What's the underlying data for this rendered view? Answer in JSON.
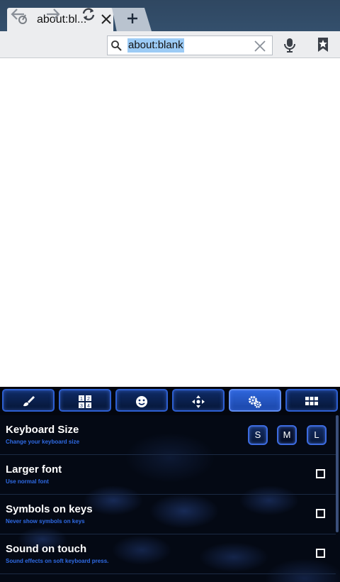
{
  "browser": {
    "tab_title": "about:bl...",
    "address_value": "about:blank"
  },
  "keyboard_tabs": [
    {
      "icon": "theme-brush-icon",
      "active": false
    },
    {
      "icon": "numpad-icon",
      "active": false
    },
    {
      "icon": "emoji-icon",
      "active": false
    },
    {
      "icon": "cursor-move-icon",
      "active": false
    },
    {
      "icon": "settings-gears-icon",
      "active": true
    },
    {
      "icon": "grid-apps-icon",
      "active": false
    }
  ],
  "settings": {
    "keyboard_size": {
      "title": "Keyboard Size",
      "subtitle": "Change your keyboard size",
      "options": [
        "S",
        "M",
        "L"
      ],
      "selected": "M"
    },
    "larger_font": {
      "title": "Larger font",
      "subtitle": "Use normal font",
      "checked": false
    },
    "symbols_on_keys": {
      "title": "Symbols on keys",
      "subtitle": "Never show symbols on keys",
      "checked": false
    },
    "sound_on_touch": {
      "title": "Sound on touch",
      "subtitle": "Sound effects on soft keyboard press.",
      "checked": false
    }
  },
  "colors": {
    "titlebar": "#34506d",
    "toolbar": "#ecedef",
    "selection": "#9ccbf5",
    "kbd_accent": "#2d5fd1",
    "subtitle_blue": "#2f6be6"
  }
}
